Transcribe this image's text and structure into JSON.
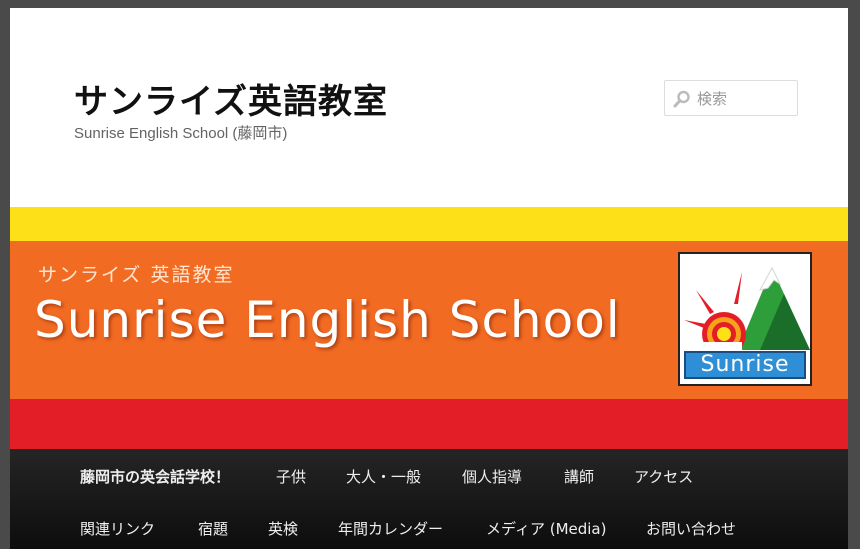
{
  "header": {
    "site_title": "サンライズ英語教室",
    "site_description": "Sunrise English School (藤岡市)"
  },
  "search": {
    "placeholder": "検索",
    "icon": "magnifier-icon"
  },
  "banner": {
    "subtitle": "サンライズ 英語教室",
    "title": "Sunrise English School",
    "logo_text": "Sunrise",
    "colors": {
      "yellow": "#fde017",
      "orange": "#f26b23",
      "red": "#e41e27",
      "logo_blue": "#2f8fd6"
    }
  },
  "nav": {
    "row1": [
      "藤岡市の英会話学校！",
      "子供",
      "大人・一般",
      "個人指導",
      "講師",
      "アクセス"
    ],
    "row2": [
      "関連リンク",
      "宿題",
      "英検",
      "年間カレンダー",
      "メディア (Media)",
      "お問い合わせ"
    ]
  }
}
